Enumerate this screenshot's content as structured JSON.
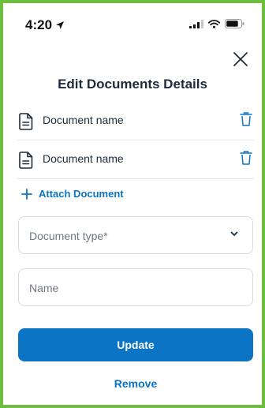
{
  "status_bar": {
    "time": "4:20"
  },
  "modal": {
    "title": "Edit Documents Details",
    "documents": [
      {
        "name": "Document name"
      },
      {
        "name": "Document name"
      }
    ],
    "attach_label": "Attach Document",
    "document_type_placeholder": "Document type*",
    "name_placeholder": "Name",
    "update_label": "Update",
    "remove_label": "Remove"
  },
  "colors": {
    "accent": "#0b74c4",
    "frame": "#6cbf3c",
    "text": "#1c2b39"
  }
}
